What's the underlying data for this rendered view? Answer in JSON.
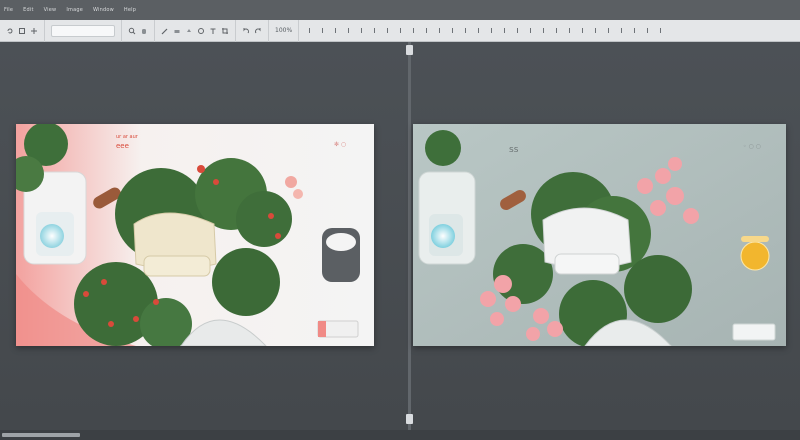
{
  "menubar": {
    "items": [
      "File",
      "Edit",
      "View",
      "Image",
      "Window",
      "Help"
    ]
  },
  "toolbar": {
    "group1_icons": [
      "rotate-icon",
      "select-icon",
      "move-icon"
    ],
    "input_value": "",
    "group2_icons": [
      "zoom-icon",
      "hand-icon"
    ],
    "group3_icons": [
      "brush-icon",
      "eraser-icon",
      "fill-icon",
      "shape-icon",
      "text-icon",
      "crop-icon"
    ],
    "group4_icons": [
      "undo-icon",
      "redo-icon"
    ],
    "zoom_label": "100%",
    "ruler_marks": 28
  },
  "left_panel": {
    "logo_line1": "ur ar aur",
    "logo_line2": "eee",
    "corner_mark": "✻ ○",
    "accent_color": "#f08a86"
  },
  "right_panel": {
    "logo_text": "ꜱꜱ",
    "corner_mark": "◦ ○ ○",
    "accent_color": "#b6c4c2"
  },
  "colors": {
    "menubar": "#5b5f63",
    "toolbar": "#e4e6e8",
    "workspace": "#4a4f54",
    "foliage": "#3e6f3a",
    "flower_red": "#d94a3a",
    "flower_pink": "#f2a3a8",
    "chair_cream": "#efe6cc",
    "chair_white": "#f1f2f2"
  }
}
